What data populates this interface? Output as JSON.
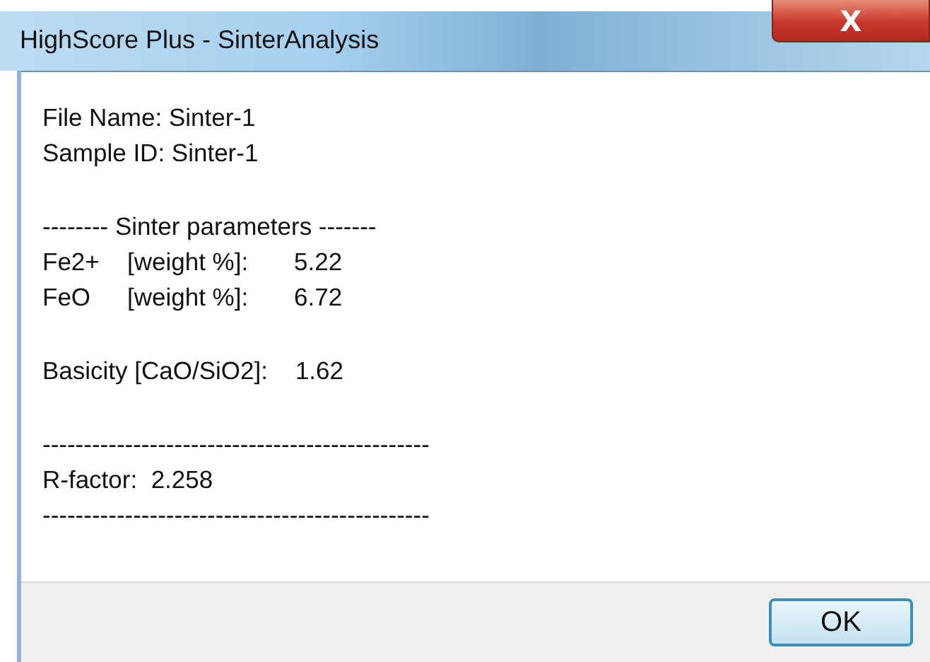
{
  "window": {
    "title": "HighScore Plus - SinterAnalysis",
    "close": "X"
  },
  "lines": [
    {
      "kind": "text",
      "cells": [
        "File Name: Sinter-1"
      ]
    },
    {
      "kind": "text",
      "cells": [
        "Sample ID: Sinter-1"
      ]
    },
    {
      "kind": "gap"
    },
    {
      "kind": "text",
      "cells": [
        "-------- Sinter parameters -------"
      ]
    },
    {
      "kind": "param",
      "cells": [
        "Fe2+",
        "[weight %]:",
        "5.22"
      ]
    },
    {
      "kind": "param",
      "cells": [
        "FeO",
        "[weight %]:",
        "6.72"
      ]
    },
    {
      "kind": "gap"
    },
    {
      "kind": "text",
      "cells": [
        "Basicity [CaO/SiO2]:    1.62"
      ]
    },
    {
      "kind": "gap"
    },
    {
      "kind": "text",
      "cells": [
        "-----------------------------------------------"
      ]
    },
    {
      "kind": "text",
      "cells": [
        "R-factor:  2.258"
      ]
    },
    {
      "kind": "text",
      "cells": [
        "-----------------------------------------------"
      ]
    }
  ],
  "buttons": [
    "OK"
  ]
}
